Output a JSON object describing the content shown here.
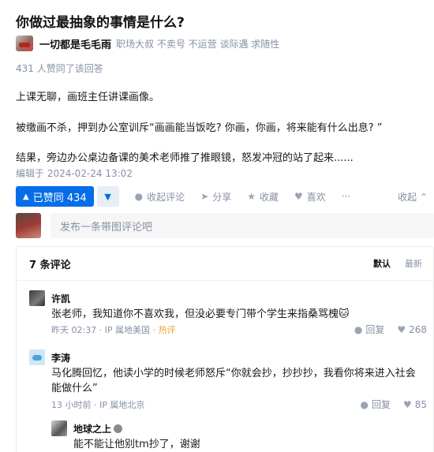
{
  "question": {
    "title": "你做过最抽象的事情是什么?"
  },
  "author": {
    "name": "一切都是毛毛雨",
    "bio": "职场大叔 不卖号 不运营 谈际遇 求随性"
  },
  "answer": {
    "approve_count_text": "431 人赞同了该回答",
    "paragraphs": [
      "上课无聊，画班主任讲课画像。",
      "被缴画不杀，押到办公室训斥“画画能当饭吃? 你画，你画，将来能有什么出息? ”",
      "结果，旁边办公桌边备课的美术老师推了推眼镜，怒发冲冠的站了起来......"
    ],
    "edit_time": "编辑于 2024-02-24 13:02"
  },
  "actions": {
    "upvote_label": "已赞同 434",
    "collapse_comments": "收起评论",
    "share": "分享",
    "favorite": "收藏",
    "like": "喜欢",
    "collapse": "收起"
  },
  "comment_input": {
    "placeholder": "发布一条带图评论吧"
  },
  "comments": {
    "header": "7 条评论",
    "sort_default": "默认",
    "sort_latest": "最新",
    "items": [
      {
        "name": "许凯",
        "text": "张老师，我知道你不喜欢我，但没必要专门带个学生来指桑骂槐",
        "emoji": "🐱",
        "meta": "昨天 02:37 · IP 属地美国 · ",
        "hot": "热评",
        "reply": "回复",
        "likes": "268"
      },
      {
        "name": "李涛",
        "text": "马化腾回忆，他读小学的时候老师怒斥“你就会抄，抄抄抄，我看你将来进入社会能做什么”",
        "meta": "13 小时前 · IP 属地北京",
        "reply": "回复",
        "likes": "85"
      },
      {
        "name": "地球之上",
        "text": "能不能让他别tm抄了，谢谢"
      }
    ]
  },
  "icons": {
    "upvote": "triangle-up-icon",
    "downvote": "triangle-down-icon",
    "comment": "comment-bubble-icon",
    "share": "paper-plane-icon",
    "favorite": "star-icon",
    "like": "heart-icon",
    "reply": "comment-bubble-icon"
  },
  "colors": {
    "accent": "#056de8",
    "muted": "#8590a6",
    "hot": "#f1a13a"
  }
}
